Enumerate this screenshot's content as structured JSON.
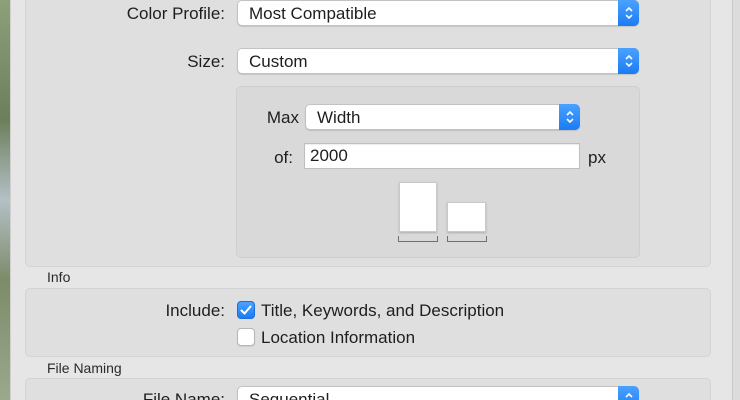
{
  "export": {
    "color_profile": {
      "label": "Color Profile:",
      "value": "Most Compatible"
    },
    "size": {
      "label": "Size:",
      "value": "Custom"
    },
    "max": {
      "label": "Max",
      "value": "Width"
    },
    "of": {
      "label": "of:",
      "value": "2000",
      "unit": "px"
    },
    "orientation_options": [
      "portrait-icon",
      "landscape-icon"
    ]
  },
  "info": {
    "section_title": "Info",
    "include_label": "Include:",
    "options": [
      {
        "label": "Title, Keywords, and Description",
        "checked": true
      },
      {
        "label": "Location Information",
        "checked": false
      }
    ]
  },
  "file_naming": {
    "section_title": "File Naming",
    "file_name_label": "File Name:",
    "file_name_value": "Sequential"
  },
  "colors": {
    "accent": "#1a7cf5",
    "panel": "#dfdfdf"
  }
}
